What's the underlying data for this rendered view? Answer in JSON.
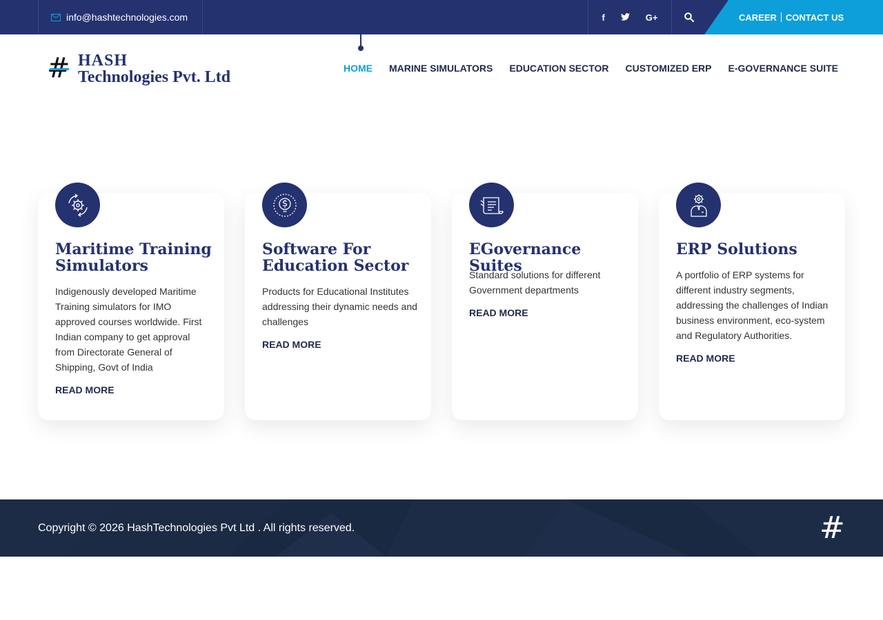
{
  "topbar": {
    "email": "info@hashtechnologies.com",
    "social": [
      "facebook-icon",
      "twitter-icon",
      "google-plus-icon"
    ],
    "social_glyphs": [
      "f",
      "t",
      "G+"
    ],
    "career": "CAREER",
    "contact": "CONTACT US"
  },
  "header": {
    "logo_symbol": "#",
    "logo_line1": "HASH",
    "logo_line2": "Technologies Pvt. Ltd",
    "nav": [
      "HOME",
      "MARINE SIMULATORS",
      "EDUCATION SECTOR",
      "CUSTOMIZED ERP",
      "E-GOVERNANCE SUITE"
    ],
    "active": "HOME"
  },
  "cards": [
    {
      "icon": "gear-cycle-icon",
      "title": "Maritime Training Simulators",
      "desc": "Indigenously developed Maritime Training simulators for IMO approved courses worldwide. First Indian company to get approval from Directorate General of Shipping, Govt of India",
      "more": "READ MORE"
    },
    {
      "icon": "dollar-bulb-icon",
      "title": "Software For Education Sector",
      "desc": "Products for Educational Institutes addressing their dynamic needs and challenges",
      "more": "READ MORE"
    },
    {
      "icon": "document-scroll-icon",
      "title": "EGovernance Suites",
      "desc": "Standard solutions for different Government departments",
      "more": "READ MORE"
    },
    {
      "icon": "person-gear-icon",
      "title": "ERP Solutions",
      "desc": "A portfolio of ERP systems for different industry segments, addressing the challenges of Indian business environment, eco-system and Regulatory Authorities.",
      "more": "READ MORE"
    }
  ],
  "footer": {
    "copyright": "Copyright © 2026 HashTechnologies Pvt Ltd . All rights reserved.",
    "logo_symbol": "#"
  },
  "colors": {
    "navy": "#253270",
    "accent": "#0c9fd9",
    "footer": "#1a2942"
  }
}
